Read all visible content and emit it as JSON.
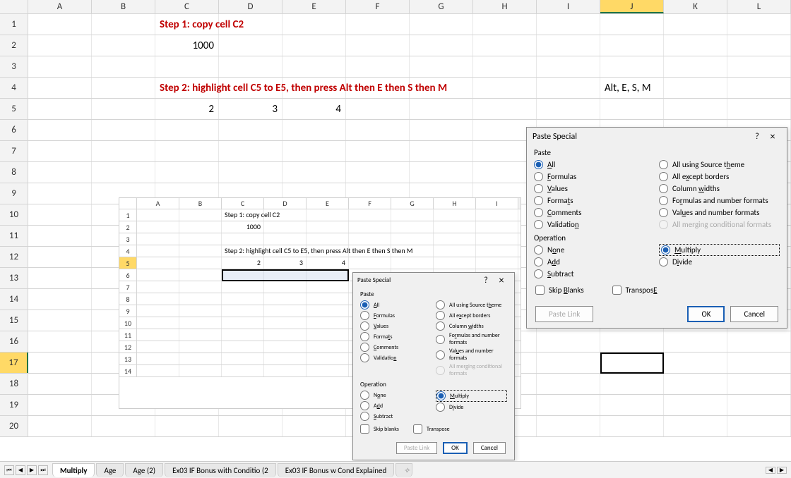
{
  "columns": [
    "A",
    "B",
    "C",
    "D",
    "E",
    "F",
    "G",
    "H",
    "I",
    "J",
    "K",
    "L"
  ],
  "selected_col": "J",
  "selected_row": 17,
  "rows": 20,
  "cells": {
    "C1": {
      "text": "Step 1: copy cell C2",
      "class": "bold"
    },
    "C2": {
      "text": "1000",
      "class": "num"
    },
    "C4": {
      "text": "Step 2: highlight cell C5 to E5, then press Alt then E then S then M",
      "class": "bold"
    },
    "J4": {
      "text": "Alt, E, S, M",
      "class": "txt"
    },
    "C5": {
      "text": "2",
      "class": "num"
    },
    "D5": {
      "text": "3",
      "class": "num"
    },
    "E5": {
      "text": "4",
      "class": "num"
    }
  },
  "inner": {
    "columns": [
      "A",
      "B",
      "C",
      "D",
      "E",
      "F",
      "G",
      "H",
      "I"
    ],
    "sel_row": 5,
    "cells": {
      "C1": "Step 1: copy cell C2",
      "C2": "1000",
      "C4": "Step 2: highlight cell C5 to E5, then press Alt then E then S then M",
      "C5": "2",
      "D5": "3",
      "E5": "4"
    },
    "rows": 14
  },
  "dialog": {
    "title": "Paste Special",
    "help": "?",
    "close": "×",
    "paste_group": "Paste",
    "paste_left": [
      {
        "key": "all",
        "label": "All",
        "u": "A",
        "checked": true
      },
      {
        "key": "formulas",
        "label": "Formulas",
        "u": "F"
      },
      {
        "key": "values",
        "label": "Values",
        "u": "V"
      },
      {
        "key": "formats",
        "label": "Formats",
        "u": "T"
      },
      {
        "key": "comments",
        "label": "Comments",
        "u": "C"
      },
      {
        "key": "validation",
        "label": "Validation",
        "u": "N"
      }
    ],
    "paste_right": [
      {
        "key": "theme",
        "label": "All using Source theme",
        "u": "H"
      },
      {
        "key": "borders",
        "label": "All except borders",
        "u": "X"
      },
      {
        "key": "widths",
        "label": "Column widths",
        "u": "W"
      },
      {
        "key": "fnf",
        "label": "Formulas and number formats",
        "u": "R"
      },
      {
        "key": "vnf",
        "label": "Values and number formats",
        "u": "U"
      },
      {
        "key": "merge",
        "label": "All merging conditional formats",
        "u": "G",
        "disabled": true
      }
    ],
    "op_group": "Operation",
    "op_left": [
      {
        "key": "none",
        "label": "None",
        "u": "O"
      },
      {
        "key": "add",
        "label": "Add",
        "u": "D"
      },
      {
        "key": "subtract",
        "label": "Subtract",
        "u": "S"
      }
    ],
    "op_right": [
      {
        "key": "multiply",
        "label": "Multiply",
        "u": "M",
        "checked": true,
        "sel": true
      },
      {
        "key": "divide",
        "label": "Divide",
        "u": "I"
      }
    ],
    "skip": "Skip blanks",
    "skip_u": "B",
    "transpose": "Transpose",
    "transpose_u": "E",
    "paste_link": "Paste Link",
    "ok": "OK",
    "cancel": "Cancel"
  },
  "tabs": {
    "list": [
      "Multiply",
      "Age",
      "Age (2)",
      "Ex03 IF Bonus with Conditio (2",
      "Ex03 IF Bonus w Cond Explained"
    ],
    "active": "Multiply"
  }
}
